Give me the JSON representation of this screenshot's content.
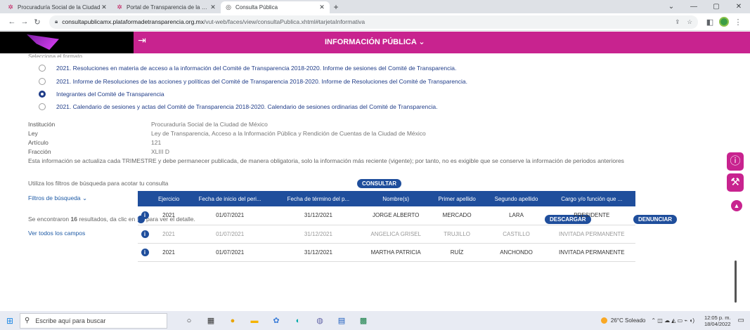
{
  "browser": {
    "tabs": [
      {
        "title": "Procuraduría Social de la Ciudad",
        "active": false
      },
      {
        "title": "Portal de Transparencia de la CDMX",
        "active": false
      },
      {
        "title": "Consulta Pública",
        "active": true
      }
    ],
    "url_host": "consultapublicamx.plataformadetransparencia.org.mx",
    "url_path": "/vut-web/faces/view/consultaPublica.xhtml#tarjetaInformativa",
    "new_tab": "+",
    "window_controls": [
      "⌄",
      "—",
      "▢",
      "✕"
    ]
  },
  "header": {
    "title": "INFORMACIÓN PÚBLICA ⌄",
    "brand_color": "#c8238f"
  },
  "form": {
    "format_label": "Selecciona el formato",
    "formats": [
      {
        "label": "2021. Resoluciones en materia de acceso a la información del Comité de Transparencia 2018-2020. Informe de sesiones del Comité de Transparencia.",
        "selected": false
      },
      {
        "label": "2021. Informe de Resoluciones de las acciones y políticas del Comité de Transparencia 2018-2020. Informe de Resoluciones del Comité de Transparencia.",
        "selected": false
      },
      {
        "label": "Integrantes del Comité de Transparencia",
        "selected": true
      },
      {
        "label": "2021. Calendario de sesiones y actas del Comité de Transparencia 2018-2020. Calendario de sesiones ordinarias del Comité de Transparencia.",
        "selected": false
      }
    ]
  },
  "meta": {
    "institucion_label": "Institución",
    "institucion_value": "Procuraduría Social de la Ciudad de México",
    "ley_label": "Ley",
    "ley_value": "Ley de Transparencia, Acceso a la Información Pública y Rendición de Cuentas de la Ciudad de México",
    "articulo_label": "Artículo",
    "articulo_value": "121",
    "fraccion_label": "Fracción",
    "fraccion_value": "XLIII D",
    "note": "Esta información se actualiza cada TRIMESTRE y debe permanecer publicada, de manera obligatoria, solo la información más reciente (vigente); por tanto, no es exigible que se conserve la información de periodos anteriores"
  },
  "search": {
    "hint": "Utiliza los filtros de búsqueda para acotar tu consulta",
    "consultar": "CONSULTAR",
    "filters": "Filtros de búsqueda ⌄"
  },
  "results": {
    "prefix": "Se encontraron",
    "count": "16",
    "suffix": "resultados, da clic en",
    "suffix2": "para ver el detalle.",
    "descargar": "DESCARGAR",
    "denunciar": "DENUNCIAR",
    "ver_todos": "Ver todos los campos"
  },
  "table": {
    "headers": [
      "",
      "Ejercicio",
      "Fecha de inicio del peri...",
      "Fecha de término del p...",
      "Nombre(s)",
      "Primer apellido",
      "Segundo apellido",
      "Cargo y/o función que ..."
    ],
    "rows": [
      {
        "ejercicio": "2021",
        "inicio": "01/07/2021",
        "termino": "31/12/2021",
        "nombre": "JORGE ALBERTO",
        "apellido1": "MERCADO",
        "apellido2": "LARA",
        "cargo": "PRESIDENTE"
      },
      {
        "ejercicio": "2021",
        "inicio": "01/07/2021",
        "termino": "31/12/2021",
        "nombre": "ANGELICA GRISEL",
        "apellido1": "TRUJILLO",
        "apellido2": "CASTILLO",
        "cargo": "INVITADA PERMANENTE"
      },
      {
        "ejercicio": "2021",
        "inicio": "01/07/2021",
        "termino": "31/12/2021",
        "nombre": "MARTHA PATRICIA",
        "apellido1": "RUÍZ",
        "apellido2": "ANCHONDO",
        "cargo": "INVITADA PERMANENTE"
      }
    ]
  },
  "taskbar": {
    "search_placeholder": "Escribe aquí para buscar",
    "weather": "26°C Soleado",
    "time": "12:05 p. m.",
    "date": "18/04/2022"
  }
}
